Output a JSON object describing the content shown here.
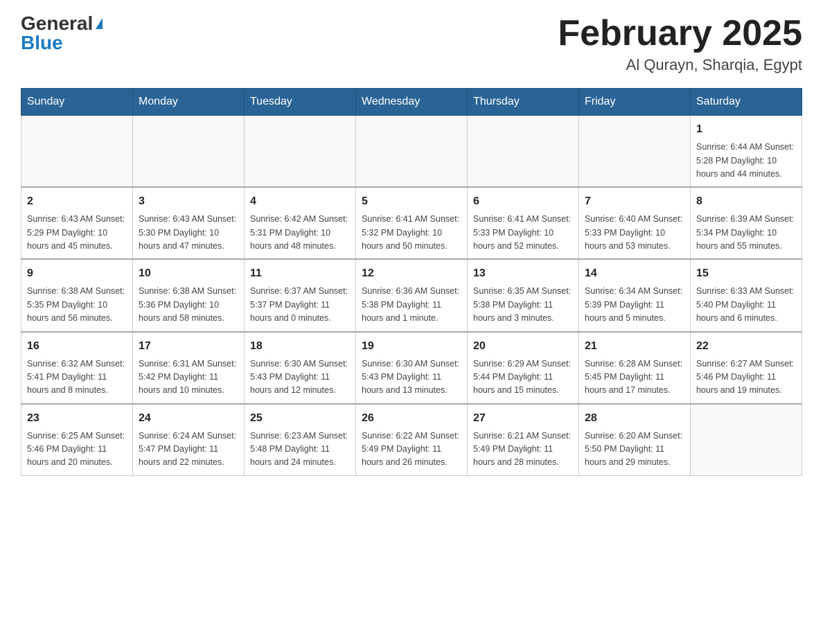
{
  "header": {
    "logo_general": "General",
    "logo_blue": "Blue",
    "month_title": "February 2025",
    "location": "Al Qurayn, Sharqia, Egypt"
  },
  "days_of_week": [
    "Sunday",
    "Monday",
    "Tuesday",
    "Wednesday",
    "Thursday",
    "Friday",
    "Saturday"
  ],
  "weeks": [
    [
      {
        "day": "",
        "info": ""
      },
      {
        "day": "",
        "info": ""
      },
      {
        "day": "",
        "info": ""
      },
      {
        "day": "",
        "info": ""
      },
      {
        "day": "",
        "info": ""
      },
      {
        "day": "",
        "info": ""
      },
      {
        "day": "1",
        "info": "Sunrise: 6:44 AM\nSunset: 5:28 PM\nDaylight: 10 hours and 44 minutes."
      }
    ],
    [
      {
        "day": "2",
        "info": "Sunrise: 6:43 AM\nSunset: 5:29 PM\nDaylight: 10 hours and 45 minutes."
      },
      {
        "day": "3",
        "info": "Sunrise: 6:43 AM\nSunset: 5:30 PM\nDaylight: 10 hours and 47 minutes."
      },
      {
        "day": "4",
        "info": "Sunrise: 6:42 AM\nSunset: 5:31 PM\nDaylight: 10 hours and 48 minutes."
      },
      {
        "day": "5",
        "info": "Sunrise: 6:41 AM\nSunset: 5:32 PM\nDaylight: 10 hours and 50 minutes."
      },
      {
        "day": "6",
        "info": "Sunrise: 6:41 AM\nSunset: 5:33 PM\nDaylight: 10 hours and 52 minutes."
      },
      {
        "day": "7",
        "info": "Sunrise: 6:40 AM\nSunset: 5:33 PM\nDaylight: 10 hours and 53 minutes."
      },
      {
        "day": "8",
        "info": "Sunrise: 6:39 AM\nSunset: 5:34 PM\nDaylight: 10 hours and 55 minutes."
      }
    ],
    [
      {
        "day": "9",
        "info": "Sunrise: 6:38 AM\nSunset: 5:35 PM\nDaylight: 10 hours and 56 minutes."
      },
      {
        "day": "10",
        "info": "Sunrise: 6:38 AM\nSunset: 5:36 PM\nDaylight: 10 hours and 58 minutes."
      },
      {
        "day": "11",
        "info": "Sunrise: 6:37 AM\nSunset: 5:37 PM\nDaylight: 11 hours and 0 minutes."
      },
      {
        "day": "12",
        "info": "Sunrise: 6:36 AM\nSunset: 5:38 PM\nDaylight: 11 hours and 1 minute."
      },
      {
        "day": "13",
        "info": "Sunrise: 6:35 AM\nSunset: 5:38 PM\nDaylight: 11 hours and 3 minutes."
      },
      {
        "day": "14",
        "info": "Sunrise: 6:34 AM\nSunset: 5:39 PM\nDaylight: 11 hours and 5 minutes."
      },
      {
        "day": "15",
        "info": "Sunrise: 6:33 AM\nSunset: 5:40 PM\nDaylight: 11 hours and 6 minutes."
      }
    ],
    [
      {
        "day": "16",
        "info": "Sunrise: 6:32 AM\nSunset: 5:41 PM\nDaylight: 11 hours and 8 minutes."
      },
      {
        "day": "17",
        "info": "Sunrise: 6:31 AM\nSunset: 5:42 PM\nDaylight: 11 hours and 10 minutes."
      },
      {
        "day": "18",
        "info": "Sunrise: 6:30 AM\nSunset: 5:43 PM\nDaylight: 11 hours and 12 minutes."
      },
      {
        "day": "19",
        "info": "Sunrise: 6:30 AM\nSunset: 5:43 PM\nDaylight: 11 hours and 13 minutes."
      },
      {
        "day": "20",
        "info": "Sunrise: 6:29 AM\nSunset: 5:44 PM\nDaylight: 11 hours and 15 minutes."
      },
      {
        "day": "21",
        "info": "Sunrise: 6:28 AM\nSunset: 5:45 PM\nDaylight: 11 hours and 17 minutes."
      },
      {
        "day": "22",
        "info": "Sunrise: 6:27 AM\nSunset: 5:46 PM\nDaylight: 11 hours and 19 minutes."
      }
    ],
    [
      {
        "day": "23",
        "info": "Sunrise: 6:25 AM\nSunset: 5:46 PM\nDaylight: 11 hours and 20 minutes."
      },
      {
        "day": "24",
        "info": "Sunrise: 6:24 AM\nSunset: 5:47 PM\nDaylight: 11 hours and 22 minutes."
      },
      {
        "day": "25",
        "info": "Sunrise: 6:23 AM\nSunset: 5:48 PM\nDaylight: 11 hours and 24 minutes."
      },
      {
        "day": "26",
        "info": "Sunrise: 6:22 AM\nSunset: 5:49 PM\nDaylight: 11 hours and 26 minutes."
      },
      {
        "day": "27",
        "info": "Sunrise: 6:21 AM\nSunset: 5:49 PM\nDaylight: 11 hours and 28 minutes."
      },
      {
        "day": "28",
        "info": "Sunrise: 6:20 AM\nSunset: 5:50 PM\nDaylight: 11 hours and 29 minutes."
      },
      {
        "day": "",
        "info": ""
      }
    ]
  ]
}
